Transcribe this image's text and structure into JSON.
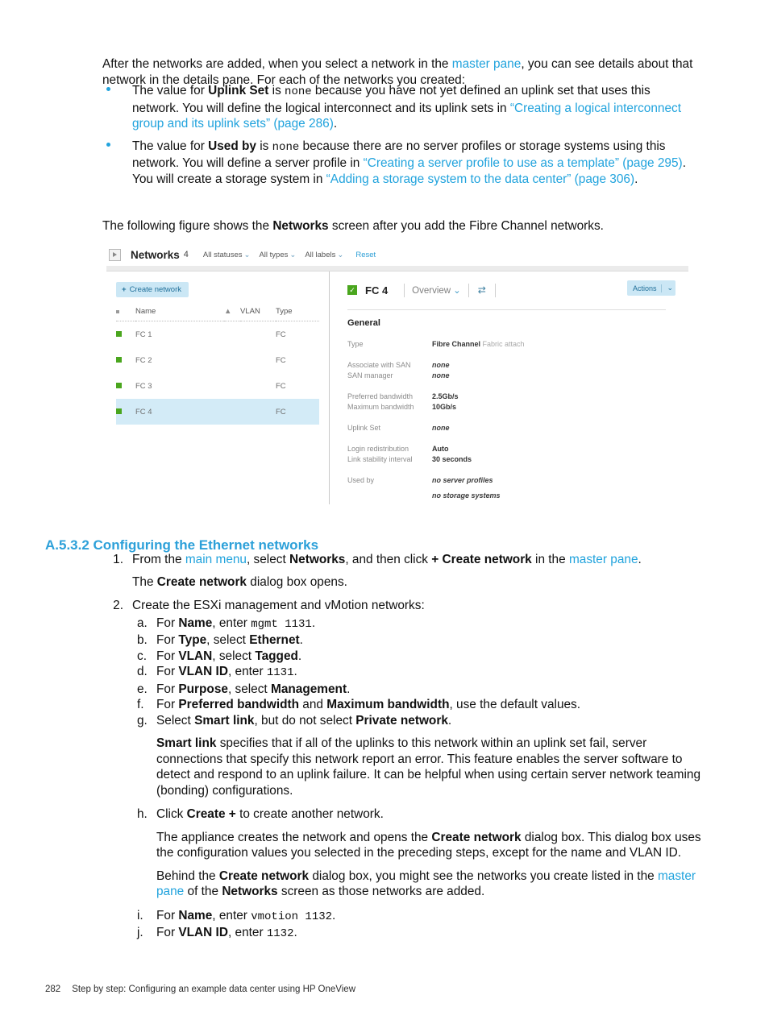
{
  "intro": {
    "part1": "After the networks are added, when you select a network in the ",
    "link1": "master pane",
    "part2": ", you can see details about that network in the details pane. For each of the networks you created:"
  },
  "bullets": [
    {
      "t1": "The value for ",
      "b1": "Uplink Set",
      "t2": " is ",
      "code1": "none",
      "t3": " because you have not yet defined an uplink set that uses this network. You will define the logical interconnect and its uplink sets in ",
      "link1": "“Creating a logical interconnect group and its uplink sets” (page 286)",
      "t4": "."
    },
    {
      "t1": "The value for ",
      "b1": "Used by",
      "t2": " is ",
      "code1": "none",
      "t3": " because there are no server profiles or storage systems using this network. You will define a server profile in ",
      "link1": "“Creating a server profile to use as a template” (page 295)",
      "t4": ". You will create a storage system in ",
      "link2": "“Adding a storage system to the data center” (page 306)",
      "t5": "."
    }
  ],
  "after_bullets": {
    "t1": "The following figure shows the ",
    "b1": "Networks",
    "t2": " screen after you add the Fibre Channel networks."
  },
  "figure": {
    "topbar": {
      "expand_icon": "expand-panel-icon",
      "title": "Networks",
      "count": "4",
      "filters": [
        {
          "label": "All statuses",
          "caret": "⌄"
        },
        {
          "label": "All types",
          "caret": "⌄"
        },
        {
          "label": "All labels",
          "caret": "⌄"
        }
      ],
      "reset": "Reset"
    },
    "master": {
      "create_button": {
        "plus": "+",
        "label": "Create network"
      },
      "columns": {
        "status": "status-dot-icon",
        "name": "Name",
        "sort": "▲",
        "vlan": "VLAN",
        "type": "Type"
      },
      "rows": [
        {
          "status": "ok",
          "name": "FC 1",
          "vlan": "",
          "type": "FC",
          "selected": false
        },
        {
          "status": "ok",
          "name": "FC 2",
          "vlan": "",
          "type": "FC",
          "selected": false
        },
        {
          "status": "ok",
          "name": "FC 3",
          "vlan": "",
          "type": "FC",
          "selected": false
        },
        {
          "status": "ok",
          "name": "FC 4",
          "vlan": "",
          "type": "FC",
          "selected": true
        }
      ]
    },
    "details": {
      "status_badge": "✓",
      "name": "FC 4",
      "view_selector": "Overview",
      "view_caret": "⌄",
      "map_icon": "⇄",
      "actions": {
        "label": "Actions",
        "caret": "⌄"
      },
      "section_title": "General",
      "groups": [
        {
          "rows": [
            {
              "label": "Type",
              "value": "Fibre Channel",
              "value_muted": " Fabric attach",
              "style": "bold"
            }
          ]
        },
        {
          "rows": [
            {
              "label": "Associate with SAN",
              "value": "none",
              "style": "italic"
            },
            {
              "label": "SAN manager",
              "value": "none",
              "style": "italic"
            }
          ]
        },
        {
          "rows": [
            {
              "label": "Preferred bandwidth",
              "value": "2.5Gb/s",
              "style": "bold"
            },
            {
              "label": "Maximum bandwidth",
              "value": "10Gb/s",
              "style": "bold"
            }
          ]
        },
        {
          "rows": [
            {
              "label": "Uplink Set",
              "value": "none",
              "style": "italic"
            }
          ]
        },
        {
          "rows": [
            {
              "label": "Login redistribution",
              "value": "Auto",
              "style": "bold"
            },
            {
              "label": "Link stability interval",
              "value": "30 seconds",
              "style": "bold"
            }
          ]
        },
        {
          "rows": [
            {
              "label": "Used by",
              "value": "no server profiles",
              "style": "italic"
            },
            {
              "label": "",
              "value": "no storage systems",
              "style": "italic"
            }
          ]
        }
      ]
    }
  },
  "section": {
    "heading": "A.5.3.2 Configuring the Ethernet networks"
  },
  "steps": {
    "step1": {
      "num": "1.",
      "t1": "From the ",
      "link1": "main menu",
      "t2": ", select ",
      "b1": "Networks",
      "t3": ", and then click ",
      "b2": "+ Create network",
      "t4": " in the ",
      "link2": "master pane",
      "t5": ".",
      "t6": "The ",
      "b3": "Create network",
      "t7": " dialog box opens."
    },
    "step2": {
      "num": "2.",
      "intro": "Create the ESXi management and vMotion networks:",
      "subs": [
        {
          "letter": "a.",
          "t1": "For ",
          "b1": "Name",
          "t2": ", enter ",
          "code": "mgmt 1131",
          "t3": "."
        },
        {
          "letter": "b.",
          "t1": "For ",
          "b1": "Type",
          "t2": ", select ",
          "b2": "Ethernet",
          "t3": "."
        },
        {
          "letter": "c.",
          "t1": "For ",
          "b1": "VLAN",
          "t2": ", select ",
          "b2": "Tagged",
          "t3": "."
        },
        {
          "letter": "d.",
          "t1": "For ",
          "b1": "VLAN ID",
          "t2": ", enter ",
          "code": "1131",
          "t3": "."
        },
        {
          "letter": "e.",
          "t1": "For ",
          "b1": "Purpose",
          "t2": ", select ",
          "b2": "Management",
          "t3": "."
        },
        {
          "letter": "f.",
          "t1": "For ",
          "b1": "Preferred bandwidth",
          "t2": " and ",
          "b2": "Maximum bandwidth",
          "t3": ", use the default values."
        },
        {
          "letter": "g.",
          "t1": "Select ",
          "b1": "Smart link",
          "t2": ", but do not select ",
          "b2": "Private network",
          "t3": "."
        }
      ],
      "smartlink_note": {
        "b1": "Smart link",
        "t1": " specifies that if all of the uplinks to this network within an uplink set fail, server connections that specify this network report an error. This feature enables the server software to detect and respond to an uplink failure. It can be helpful when using certain server network teaming (bonding) configurations."
      },
      "sub_h": {
        "letter": "h.",
        "t1": "Click ",
        "b1": "Create +",
        "t2": " to create another network."
      },
      "h_para1": {
        "t1": "The appliance creates the network and opens the ",
        "b1": "Create network",
        "t2": " dialog box. This dialog box uses the configuration values you selected in the preceding steps, except for the name and VLAN ID."
      },
      "h_para2": {
        "t1": "Behind the ",
        "b1": "Create network",
        "t2": " dialog box, you might see the networks you create listed in the ",
        "link1": "master pane",
        "t3": " of the ",
        "b2": "Networks",
        "t4": " screen as those networks are added."
      },
      "sub_i": {
        "letter": "i.",
        "t1": "For ",
        "b1": "Name",
        "t2": ", enter ",
        "code": "vmotion 1132",
        "t3": "."
      },
      "sub_j": {
        "letter": "j.",
        "t1": "For ",
        "b1": "VLAN ID",
        "t2": ", enter ",
        "code": "1132",
        "t3": "."
      }
    }
  },
  "footer": {
    "page_number": "282",
    "text": "Step by step: Configuring an example data center using HP OneView"
  },
  "colors": {
    "link_blue": "#21a3dd",
    "heading_blue": "#2ca0d9",
    "status_green": "#4aa61e",
    "selected_row": "#d3ebf7",
    "button_blue": "#cbe7f5"
  }
}
